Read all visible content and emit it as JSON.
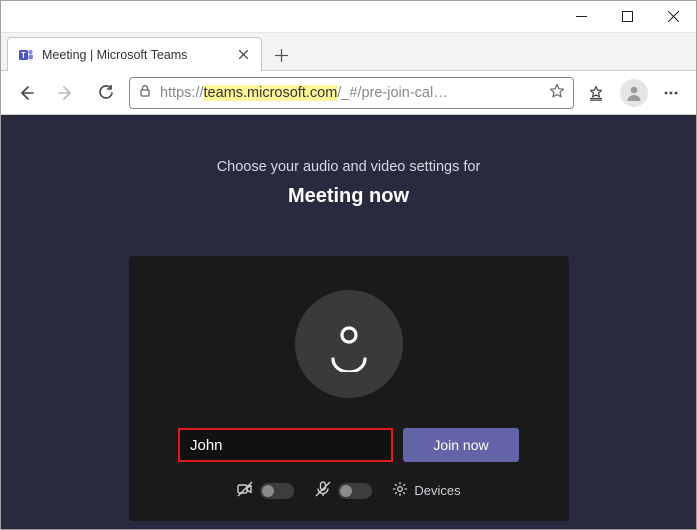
{
  "window": {
    "tab_title": "Meeting | Microsoft Teams"
  },
  "addressbar": {
    "protocol": "https://",
    "highlight": "teams.microsoft.com",
    "rest": "/_#/pre-join-cal…"
  },
  "page": {
    "prompt": "Choose your audio and video settings for",
    "meeting_title": "Meeting now",
    "name_value": "John",
    "join_label": "Join now",
    "devices_label": "Devices"
  }
}
